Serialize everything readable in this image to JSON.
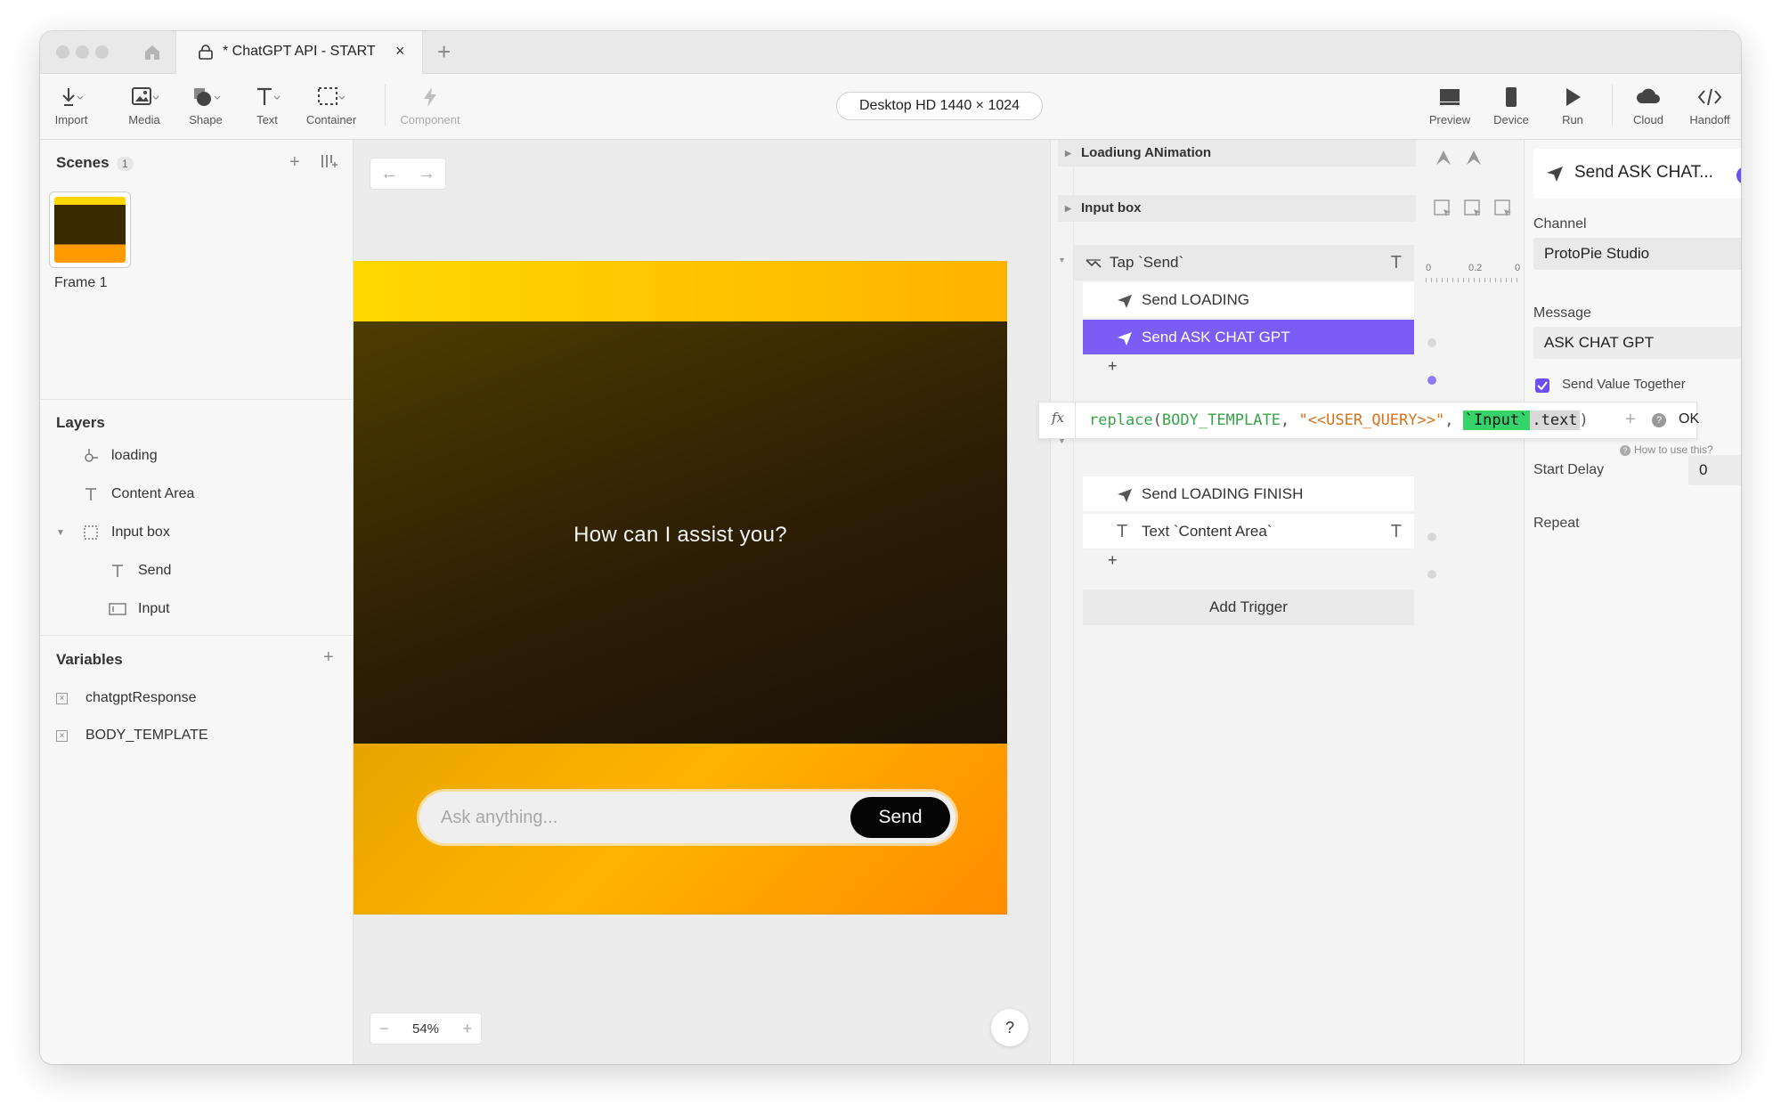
{
  "window": {
    "tab_title": "* ChatGPT API - START",
    "tab_close": "×",
    "tab_add": "+"
  },
  "toolbar": {
    "tools": [
      {
        "label": "Import",
        "icon": "import-icon"
      },
      {
        "label": "Media",
        "icon": "media-icon"
      },
      {
        "label": "Shape",
        "icon": "shape-icon"
      },
      {
        "label": "Text",
        "icon": "text-icon"
      },
      {
        "label": "Container",
        "icon": "container-icon"
      },
      {
        "label": "Component",
        "icon": "component-icon"
      }
    ],
    "device": "Desktop HD  1440 × 1024",
    "right_tools": [
      {
        "label": "Preview",
        "icon": "preview-icon"
      },
      {
        "label": "Device",
        "icon": "device-icon"
      },
      {
        "label": "Run",
        "icon": "run-icon"
      },
      {
        "label": "Cloud",
        "icon": "cloud-icon"
      },
      {
        "label": "Handoff",
        "icon": "handoff-icon"
      }
    ]
  },
  "scenes": {
    "title": "Scenes",
    "count": "1",
    "add": "+",
    "items": [
      {
        "label": "Frame 1"
      }
    ]
  },
  "layers": {
    "title": "Layers",
    "items": [
      {
        "label": "loading",
        "icon": "animation-icon"
      },
      {
        "label": "Content Area",
        "icon": "text-icon"
      },
      {
        "label": "Input box",
        "icon": "container-icon"
      },
      {
        "label": "Send",
        "icon": "text-icon"
      },
      {
        "label": "Input",
        "icon": "input-icon"
      }
    ]
  },
  "variables": {
    "title": "Variables",
    "add": "+",
    "items": [
      {
        "label": "chatgptResponse"
      },
      {
        "label": "BODY_TEMPLATE"
      }
    ]
  },
  "canvas": {
    "content_text": "How can I assist you?",
    "input_placeholder": "Ask anything...",
    "send_label": "Send",
    "zoom": "54%",
    "zoom_minus": "−",
    "zoom_plus": "+",
    "help": "?",
    "nav_back": "←",
    "nav_forward": "→",
    "colors": {
      "top": "#ffd800",
      "middle": "#3a2a04",
      "bottom": "#ff9a00"
    }
  },
  "interactions": {
    "groups": [
      {
        "label": "Loadiung ANimation"
      },
      {
        "label": "Input box"
      }
    ],
    "trigger": "Tap `Send`",
    "responses_a": [
      {
        "label": "Send LOADING"
      },
      {
        "label": "Send ASK CHAT GPT"
      }
    ],
    "responses_b": [
      {
        "label": "Send LOADING FINISH"
      },
      {
        "label": "Text `Content Area`"
      }
    ],
    "add": "+",
    "add_trigger": "Add Trigger",
    "timeline": {
      "t0": "0",
      "t1": "0.2",
      "t2": "0"
    }
  },
  "formula": {
    "fx": "fx",
    "fn": "replace",
    "arg1": "BODY_TEMPLATE",
    "arg2": "\"<<USER_QUERY>>\"",
    "arg3": "`Input`",
    "arg3_prop": ".text",
    "ok": "OK",
    "help": "?",
    "add": "+",
    "how_to": "How to use this?"
  },
  "properties": {
    "title": "Send ASK CHAT...",
    "enabled": true,
    "channel_label": "Channel",
    "channel_value": "ProtoPie Studio",
    "message_label": "Message",
    "message_value": "ASK CHAT GPT",
    "send_value_label": "Send Value Together",
    "send_value_checked": true,
    "start_delay_label": "Start Delay",
    "start_delay_value": "0",
    "repeat_label": "Repeat",
    "repeat_checked": false,
    "accent": "#6d4ef5"
  }
}
